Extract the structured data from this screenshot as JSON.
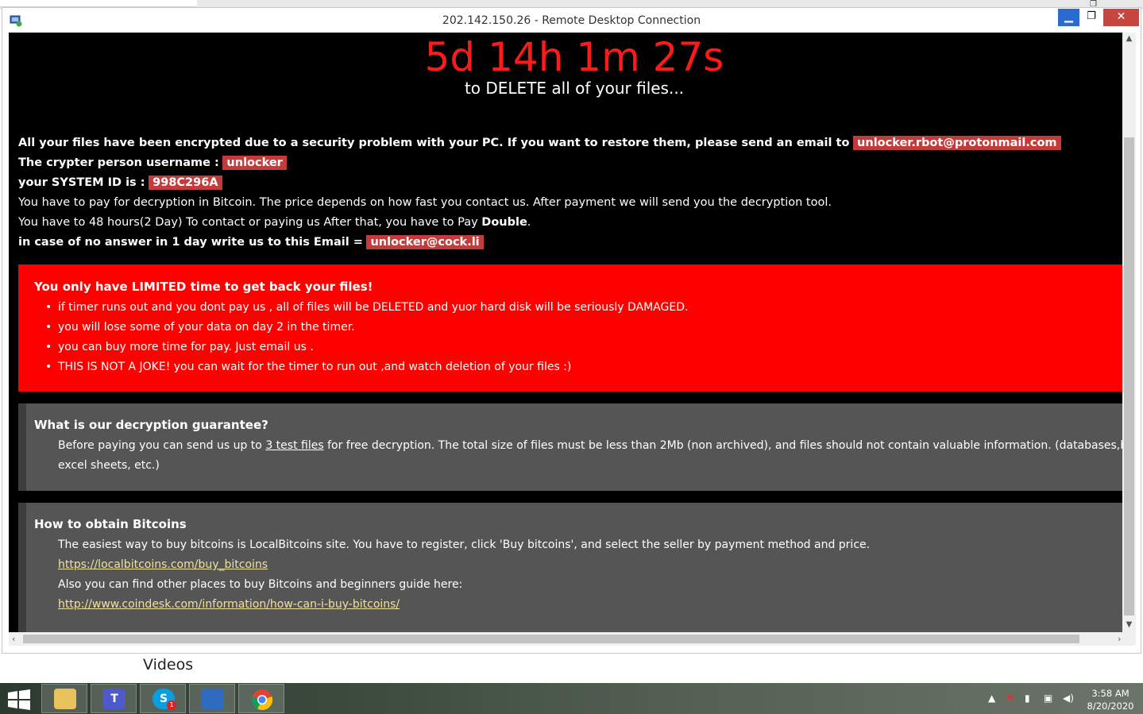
{
  "window": {
    "title": "202.142.150.26 - Remote Desktop Connection",
    "minimize": "▁",
    "maximize": "❐",
    "close": "✕"
  },
  "note": {
    "timer": "5d 14h 1m 27s",
    "timer_sub": "to DELETE all of your files...",
    "line1_text": "All your files have been encrypted due to a security problem with your PC. If you want to restore them, please send an email to",
    "line1_email": "unlocker.rbot@protonmail.com",
    "line2_text": "The crypter person username :",
    "line2_value": "unlocker",
    "line3_text": "your SYSTEM ID is :",
    "line3_value": "998C296A",
    "line4": "You have to pay for decryption in Bitcoin. The price depends on how fast you contact us. After payment we will send you the decryption tool.",
    "line5_pre": "You have to 48 hours(2 Day) To contact or paying us After that, you have to Pay",
    "line5_bold": "Double",
    "line5_post": ".",
    "line6_text": "in case of no answer in 1 day write us to this Email =",
    "line6_email": "unlocker@cock.li"
  },
  "limited": {
    "heading": "You only have LIMITED time to get back your files!",
    "items": [
      "if timer runs out and you dont pay us , all of files will be DELETED and yuor hard disk will be seriously DAMAGED.",
      "you will lose some of your data on day 2 in the timer.",
      "you can buy more time for pay. Just email us .",
      "THIS IS NOT A JOKE! you can wait for the timer to run out ,and watch deletion of your files :)"
    ]
  },
  "guarantee": {
    "heading": "What is our decryption guarantee?",
    "text_pre": "Before paying you can send us up to",
    "text_link": "3 test files",
    "text_post": "for free decryption. The total size of files must be less than 2Mb (non archived), and files should not contain valuable information. (databases,backups, large",
    "text_line2": "excel sheets, etc.)"
  },
  "bitcoins": {
    "heading": "How to obtain Bitcoins",
    "text1": "The easiest way to buy bitcoins is LocalBitcoins site. You have to register, click 'Buy bitcoins', and select the seller by payment method and price.",
    "link1": "https://localbitcoins.com/buy_bitcoins",
    "text2": "Also you can find other places to buy Bitcoins and beginners guide here:",
    "link2": "http://www.coindesk.com/information/how-can-i-buy-bitcoins/"
  },
  "background": {
    "videos_label": "Videos"
  },
  "taskbar": {
    "time": "3:58 AM",
    "date": "8/20/2020",
    "skype_badge": "1"
  },
  "colors": {
    "timer": "#ff1a1a",
    "red_box": "#ff0000",
    "tag": "#c43b3b",
    "grey_box": "#555555",
    "minimize_btn": "#2b6bd1",
    "close_btn": "#c7463f"
  }
}
